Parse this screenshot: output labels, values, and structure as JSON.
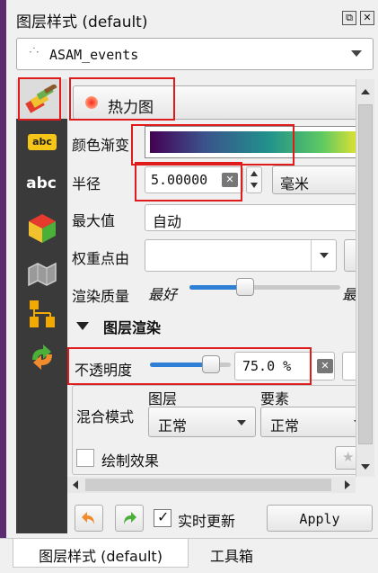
{
  "panel": {
    "title": "图层样式 (default)",
    "title_btn_float": "⧉",
    "title_btn_close": "✕"
  },
  "layer_selector": {
    "value": "ASAM_events"
  },
  "sidebar": {
    "items": [
      {
        "name": "symbology-brush-icon",
        "label": ""
      },
      {
        "name": "labels-icon",
        "label": "abc"
      },
      {
        "name": "masks-icon",
        "label": "abc"
      },
      {
        "name": "3d-view-icon",
        "label": ""
      },
      {
        "name": "diagrams-icon",
        "label": ""
      },
      {
        "name": "fields-icon",
        "label": ""
      },
      {
        "name": "actions-icon",
        "label": ""
      }
    ]
  },
  "renderer": {
    "value": "热力图"
  },
  "heatmap": {
    "color_ramp_label": "颜色渐变",
    "radius_label": "半径",
    "radius_value": "5.00000",
    "radius_unit": "毫米",
    "max_value_label": "最大值",
    "max_value_value": "自动",
    "weight_label": "权重点由",
    "weight_value": "",
    "quality_label": "渲染质量",
    "quality_left": "最好",
    "quality_right": "最",
    "quality_level": 0.37
  },
  "layer_rendering": {
    "section_title": "图层渲染",
    "opacity_label": "不透明度",
    "opacity_value": "75.0 %",
    "opacity_level": 0.75,
    "blend_label": "混合模式",
    "blend_layer_header": "图层",
    "blend_layer_value": "正常",
    "blend_feature_header": "要素",
    "blend_feature_value": "正常",
    "draw_effects_label": "绘制效果"
  },
  "footer": {
    "live_update_label": "实时更新",
    "live_update_checked": true,
    "apply_label": "Apply"
  },
  "tabs": [
    {
      "label": "图层样式 (default)",
      "active": true
    },
    {
      "label": "工具箱",
      "active": false
    }
  ],
  "colors": {
    "highlight_red": "#e01b1b",
    "slider_blue": "#2f7fd6",
    "sidebar_bg": "#3a3a3a"
  }
}
